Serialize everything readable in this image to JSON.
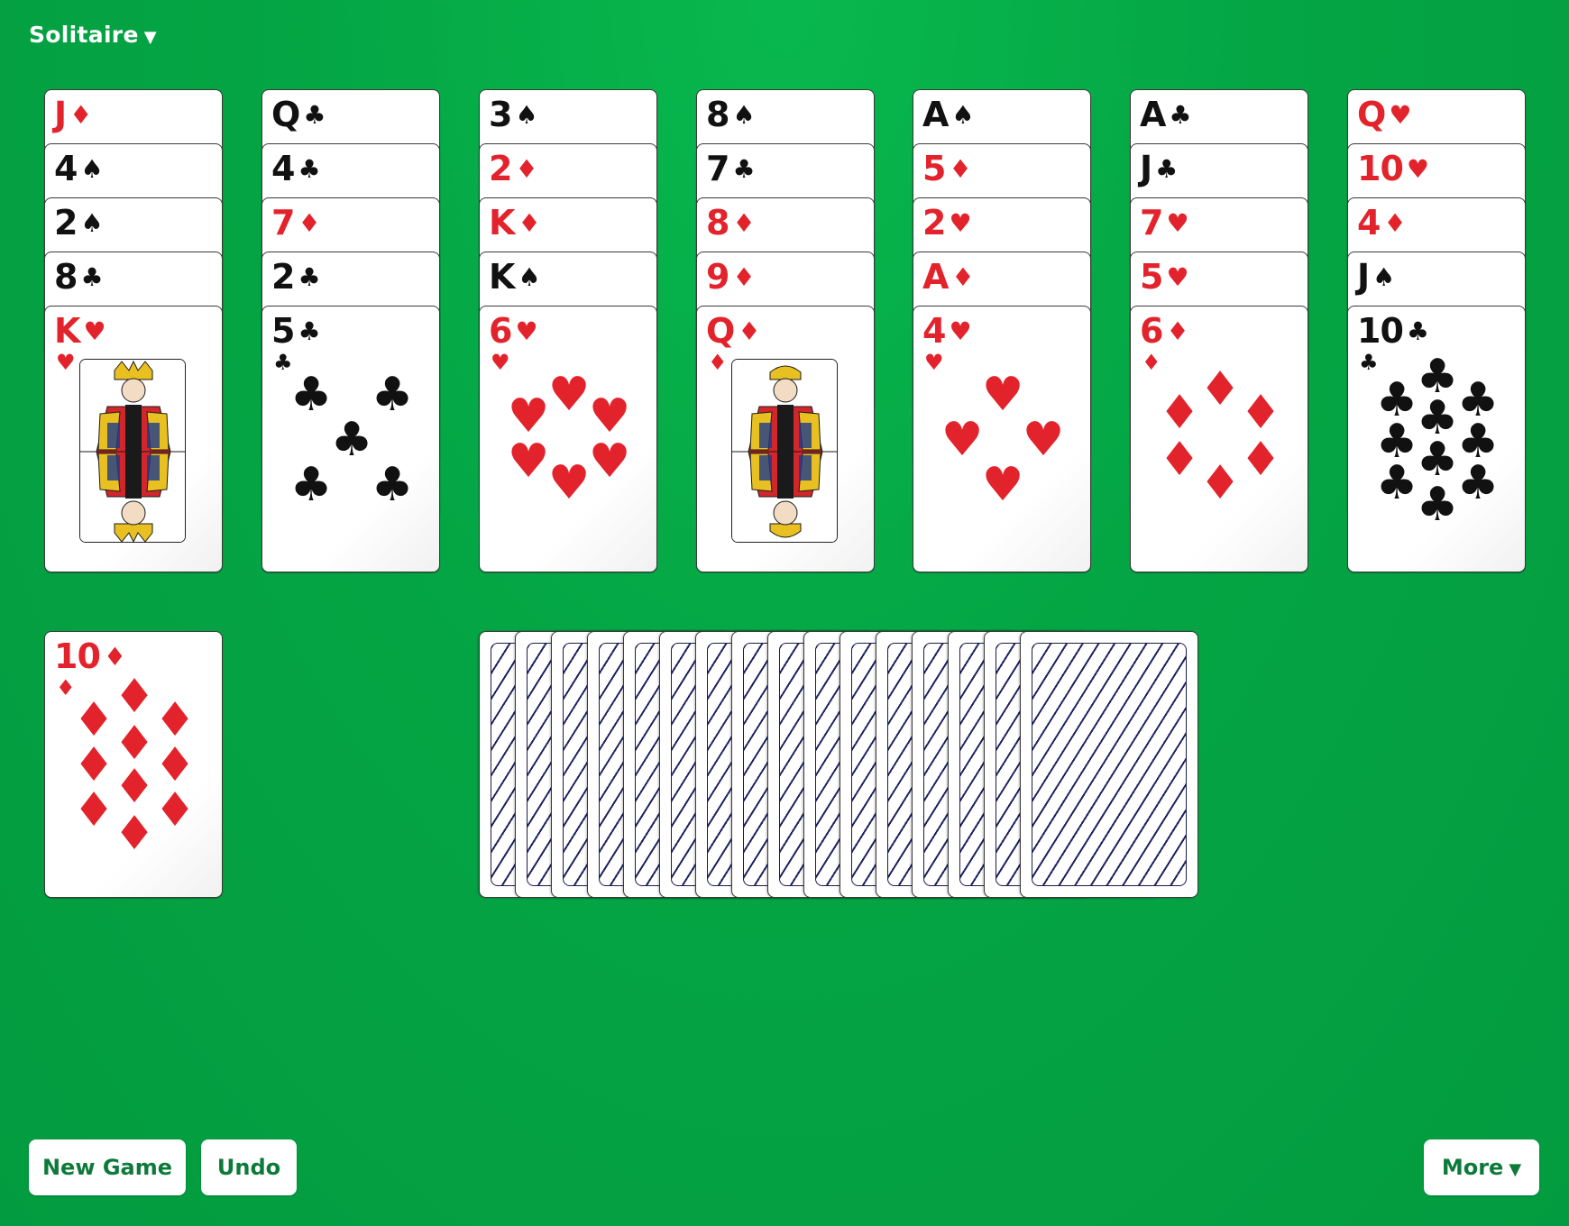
{
  "menu": {
    "title": "Solitaire",
    "caret": "▼"
  },
  "tableau": [
    {
      "cards": [
        {
          "rank": "J",
          "suit": "♦"
        },
        {
          "rank": "4",
          "suit": "♠"
        },
        {
          "rank": "2",
          "suit": "♠"
        },
        {
          "rank": "8",
          "suit": "♣"
        },
        {
          "rank": "K",
          "suit": "♥",
          "face_up": true
        }
      ]
    },
    {
      "cards": [
        {
          "rank": "Q",
          "suit": "♣"
        },
        {
          "rank": "4",
          "suit": "♣"
        },
        {
          "rank": "7",
          "suit": "♦"
        },
        {
          "rank": "2",
          "suit": "♣"
        },
        {
          "rank": "5",
          "suit": "♣",
          "face_up": true
        }
      ]
    },
    {
      "cards": [
        {
          "rank": "3",
          "suit": "♠"
        },
        {
          "rank": "2",
          "suit": "♦"
        },
        {
          "rank": "K",
          "suit": "♦"
        },
        {
          "rank": "K",
          "suit": "♠"
        },
        {
          "rank": "6",
          "suit": "♥",
          "face_up": true
        }
      ]
    },
    {
      "cards": [
        {
          "rank": "8",
          "suit": "♠"
        },
        {
          "rank": "7",
          "suit": "♣"
        },
        {
          "rank": "8",
          "suit": "♦"
        },
        {
          "rank": "9",
          "suit": "♦"
        },
        {
          "rank": "Q",
          "suit": "♦",
          "face_up": true
        }
      ]
    },
    {
      "cards": [
        {
          "rank": "A",
          "suit": "♠"
        },
        {
          "rank": "5",
          "suit": "♦"
        },
        {
          "rank": "2",
          "suit": "♥"
        },
        {
          "rank": "A",
          "suit": "♦"
        },
        {
          "rank": "4",
          "suit": "♥",
          "face_up": true
        }
      ]
    },
    {
      "cards": [
        {
          "rank": "A",
          "suit": "♣"
        },
        {
          "rank": "J",
          "suit": "♣"
        },
        {
          "rank": "7",
          "suit": "♥"
        },
        {
          "rank": "5",
          "suit": "♥"
        },
        {
          "rank": "6",
          "suit": "♦",
          "face_up": true
        }
      ]
    },
    {
      "cards": [
        {
          "rank": "Q",
          "suit": "♥"
        },
        {
          "rank": "10",
          "suit": "♥"
        },
        {
          "rank": "4",
          "suit": "♦"
        },
        {
          "rank": "J",
          "suit": "♠"
        },
        {
          "rank": "10",
          "suit": "♣",
          "face_up": true
        }
      ]
    }
  ],
  "waste": {
    "rank": "10",
    "suit": "♦"
  },
  "stock": {
    "count": 16
  },
  "colors": {
    "felt": "#04a544",
    "red": "#e3232c",
    "black": "#111111",
    "button_text": "#0d7a3a",
    "card_back_lines": "#1f2460"
  },
  "buttons": {
    "new_game": "New Game",
    "undo": "Undo",
    "more": "More",
    "more_caret": "▼"
  }
}
